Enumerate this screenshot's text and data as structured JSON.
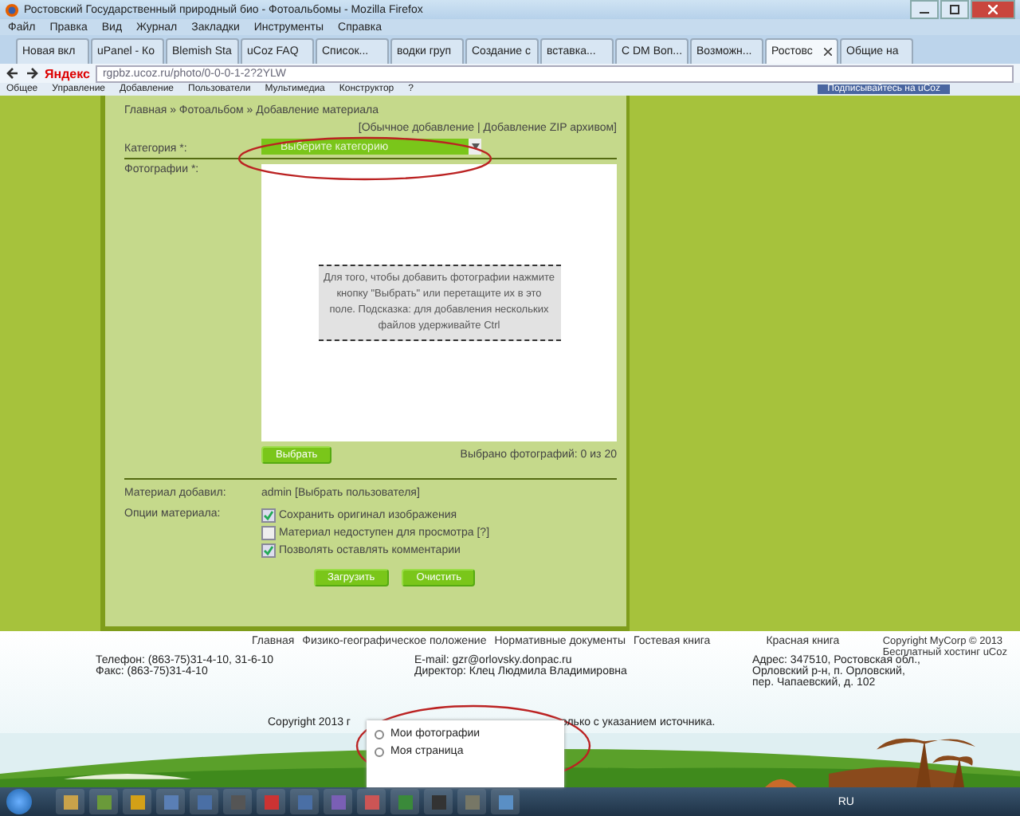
{
  "window": {
    "title": "Ростовский Государственный природный био - Фотоальбомы - Mozilla Firefox"
  },
  "menu": [
    "Файл",
    "Правка",
    "Вид",
    "Журнал",
    "Закладки",
    "Инструменты",
    "Справка"
  ],
  "tabs": [
    {
      "label": "Новая вкл",
      "selected": false
    },
    {
      "label": "uPanel - Ко",
      "selected": false
    },
    {
      "label": "Blemish Sta",
      "selected": false
    },
    {
      "label": "uCoz FAQ",
      "selected": false
    },
    {
      "label": "Список...",
      "selected": false
    },
    {
      "label": "водки груп",
      "selected": false
    },
    {
      "label": "Создание с",
      "selected": false
    },
    {
      "label": "вставка...",
      "selected": false
    },
    {
      "label": "C DM Воп...",
      "selected": false
    },
    {
      "label": "Возможн...",
      "selected": false
    },
    {
      "label": "Ростовс",
      "selected": true
    },
    {
      "label": "Общие на",
      "selected": false
    }
  ],
  "navbar": {
    "search_brand": "Яндекс",
    "url": "rgpbz.ucoz.ru/photo/0-0-0-1-2?2YLW"
  },
  "admin_bar": {
    "items": [
      "Общее",
      "Управление",
      "Добавление",
      "Пользователи",
      "Мультимедиа",
      "Конструктор",
      "?"
    ],
    "subscribe": "Подписывайтесь на uCoz"
  },
  "form": {
    "breadcrumb": "Главная » Фотоальбом » Добавление материала",
    "mode_links": [
      "[Обычное добавление",
      "| Добавление ZIP архивом]"
    ],
    "category_label": "Категория *:",
    "category_value": "Выберите категорию",
    "photos_label": "Фотографии *:",
    "drop_hint": "Для того, чтобы добавить фотографии нажмите кнопку \"Выбрать\" или перетащите их в это поле. Подсказка: для добавления нескольких файлов удерживайте Ctrl",
    "choose_button": "Выбрать",
    "selected_count": "Выбрано фотографий: 0 из 20",
    "author_label": "Материал добавил:",
    "author": "admin",
    "author_link": "[Выбрать пользователя]",
    "options_label": "Опции материала:",
    "options": [
      {
        "label": "Сохранить оригинал изображения",
        "checked": true
      },
      {
        "label": "Материал недоступен для просмотра [?]",
        "checked": false
      },
      {
        "label": "Позволять оставлять комментарии",
        "checked": true
      }
    ],
    "buttons": [
      "Загрузить",
      "Очистить"
    ]
  },
  "footer": {
    "links": [
      "Главная",
      "Физико-географическое положение",
      "Нормативные документы",
      "Гостевая книга",
      "Красная книга"
    ],
    "copyright_right": [
      "Copyright MyCorp © 2013",
      "Бесплатный хостинг uCoz"
    ],
    "contacts_left": [
      "Телефон: (863-75)31-4-10, 31-6-10",
      "Факс: (863-75)31-4-10"
    ],
    "contacts_mid": [
      "E-mail: gzr@orlovsky.donpac.ru",
      "Директор: Клец Людмила Владимировна"
    ],
    "contacts_right": [
      "Адрес: 347510, Ростовская обл.,",
      "Орловский р-н, п. Орловский,",
      "пер. Чапаевский, д. 102"
    ],
    "copyright_left": "Copyright 2013 г",
    "copyright_tail": "олько с указанием источника."
  },
  "popup_menu": [
    "Мои фотографии",
    "Моя страница"
  ],
  "taskbar": {
    "language": "RU"
  }
}
